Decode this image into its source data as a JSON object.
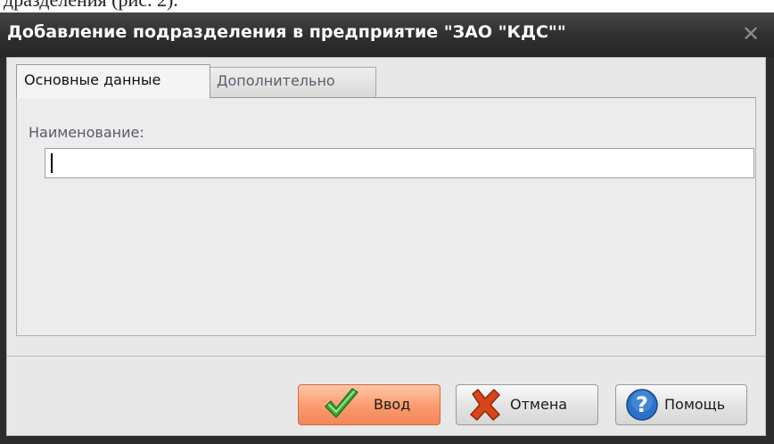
{
  "doc_snippet": "дразделения (рис. 2).",
  "window": {
    "title": "Добавление подразделения в предприятие \"ЗАО \"КДС\"\"",
    "close_icon": "close-icon"
  },
  "tabs": [
    {
      "label": "Основные данные",
      "active": true
    },
    {
      "label": "Дополнительно",
      "active": false
    }
  ],
  "form": {
    "name_label": "Наименование:",
    "name_value": "",
    "name_placeholder": ""
  },
  "buttons": {
    "ok": {
      "label": "Ввод",
      "icon": "checkmark-icon"
    },
    "cancel": {
      "label": "Отмена",
      "icon": "red-x-icon"
    },
    "help": {
      "label": "Помощь",
      "icon": "help-question-icon"
    }
  },
  "colors": {
    "titlebar": "#2e2e2e",
    "ok_button": "#f9976a",
    "check_green": "#3fa83a",
    "cancel_red": "#d9441a",
    "help_blue": "#2a73c9"
  }
}
